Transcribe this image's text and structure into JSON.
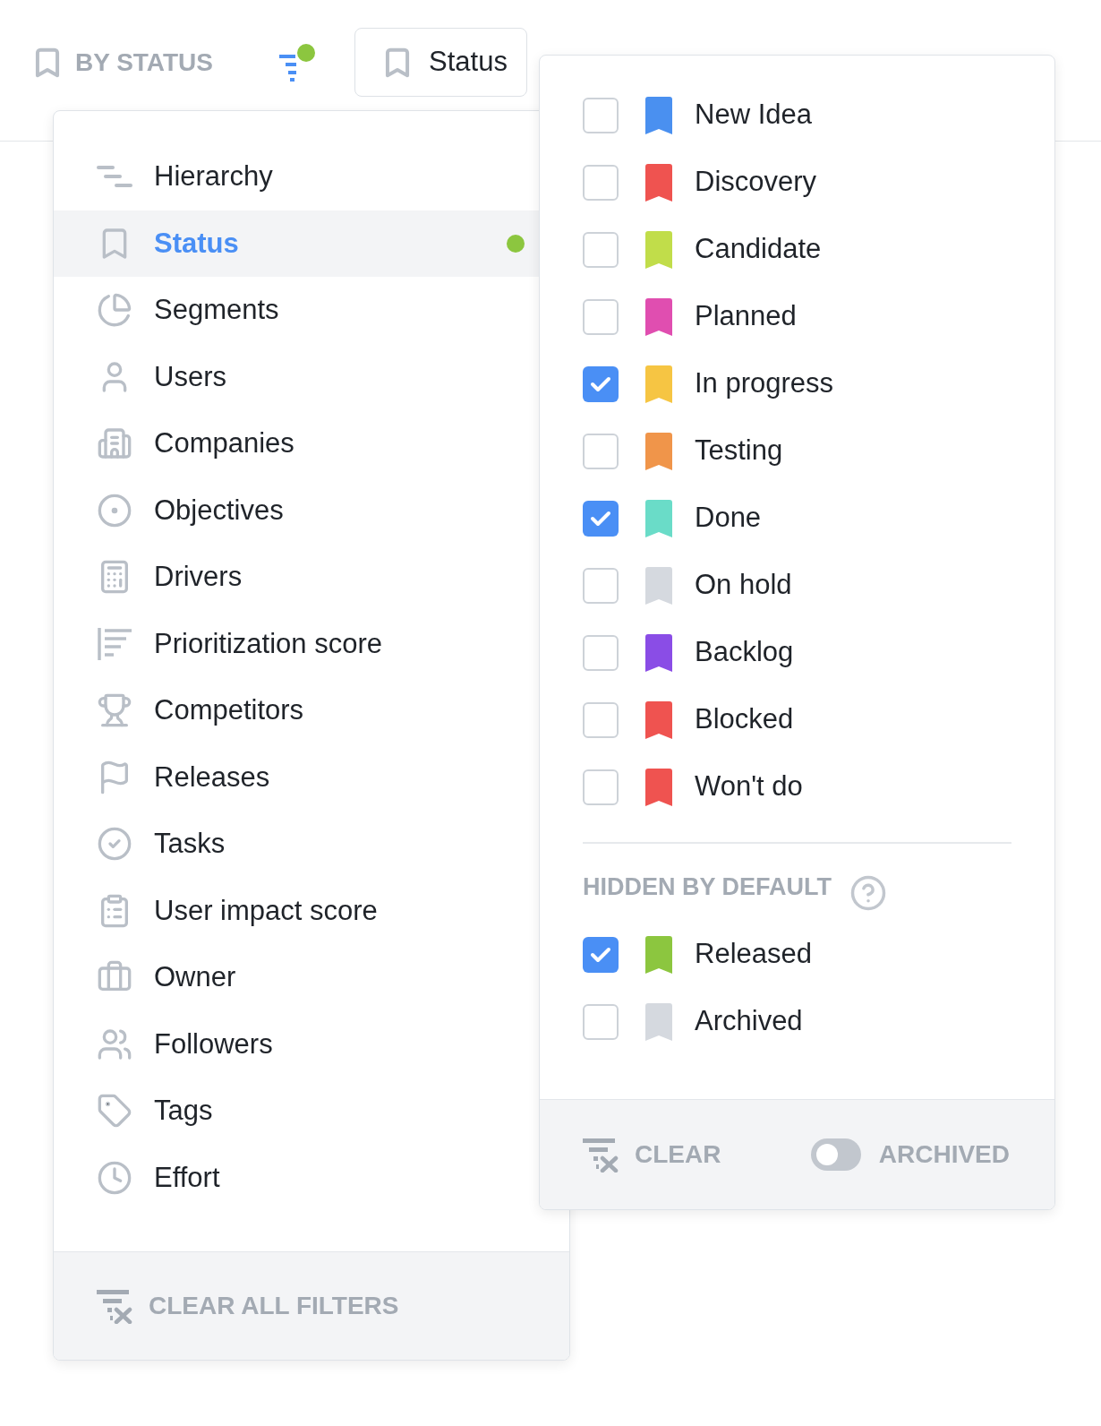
{
  "toolbar": {
    "group_label": "BY STATUS",
    "filter_active": true,
    "status_button": "Status"
  },
  "menu": {
    "items": [
      {
        "label": "Hierarchy",
        "selected": false,
        "filtered": false
      },
      {
        "label": "Status",
        "selected": true,
        "filtered": true
      },
      {
        "label": "Segments",
        "selected": false,
        "filtered": false
      },
      {
        "label": "Users",
        "selected": false,
        "filtered": false
      },
      {
        "label": "Companies",
        "selected": false,
        "filtered": false
      },
      {
        "label": "Objectives",
        "selected": false,
        "filtered": false
      },
      {
        "label": "Drivers",
        "selected": false,
        "filtered": false
      },
      {
        "label": "Prioritization score",
        "selected": false,
        "filtered": false
      },
      {
        "label": "Competitors",
        "selected": false,
        "filtered": false
      },
      {
        "label": "Releases",
        "selected": false,
        "filtered": false
      },
      {
        "label": "Tasks",
        "selected": false,
        "filtered": false
      },
      {
        "label": "User impact score",
        "selected": false,
        "filtered": false
      },
      {
        "label": "Owner",
        "selected": false,
        "filtered": false
      },
      {
        "label": "Followers",
        "selected": false,
        "filtered": false
      },
      {
        "label": "Tags",
        "selected": false,
        "filtered": false
      },
      {
        "label": "Effort",
        "selected": false,
        "filtered": false
      }
    ],
    "footer": "CLEAR ALL FILTERS"
  },
  "status_panel": {
    "statuses": [
      {
        "label": "New Idea",
        "checked": false,
        "color": "#4a90f0"
      },
      {
        "label": "Discovery",
        "checked": false,
        "color": "#ef5350"
      },
      {
        "label": "Candidate",
        "checked": false,
        "color": "#c1dd4a"
      },
      {
        "label": "Planned",
        "checked": false,
        "color": "#e04eb0"
      },
      {
        "label": "In progress",
        "checked": true,
        "color": "#f6c543"
      },
      {
        "label": "Testing",
        "checked": false,
        "color": "#f0954a"
      },
      {
        "label": "Done",
        "checked": true,
        "color": "#6adcc8"
      },
      {
        "label": "On hold",
        "checked": false,
        "color": "#d5d9df"
      },
      {
        "label": "Backlog",
        "checked": false,
        "color": "#8a4de6"
      },
      {
        "label": "Blocked",
        "checked": false,
        "color": "#ef5350"
      },
      {
        "label": "Won't do",
        "checked": false,
        "color": "#ef5350"
      }
    ],
    "hidden_heading": "HIDDEN BY DEFAULT",
    "hidden_statuses": [
      {
        "label": "Released",
        "checked": true,
        "color": "#8cc63f"
      },
      {
        "label": "Archived",
        "checked": false,
        "color": "#d5d9df"
      }
    ],
    "clear": "CLEAR",
    "archived_toggle": {
      "label": "ARCHIVED",
      "on": false
    }
  }
}
